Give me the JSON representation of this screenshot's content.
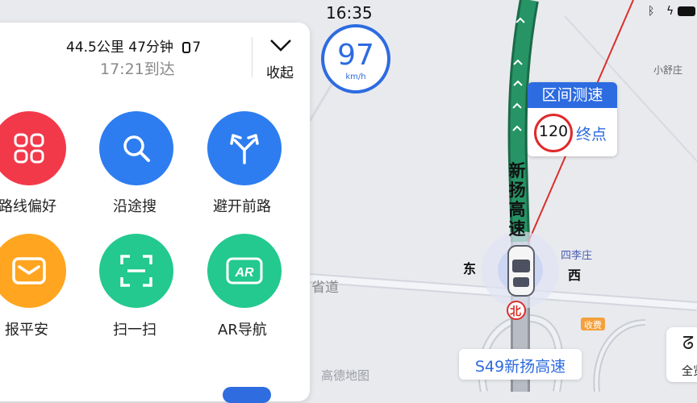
{
  "status_bar": {
    "time": "16:35"
  },
  "panel": {
    "distance_time": "44.5公里 47分钟",
    "traffic_lights": "7",
    "eta": "17:21到达",
    "collapse_label": "收起",
    "functions": [
      {
        "label": "路线偏好",
        "icon": "route-preference-icon",
        "color": "#f2394a"
      },
      {
        "label": "沿途搜",
        "icon": "search-icon",
        "color": "#2d7df0"
      },
      {
        "label": "避开前路",
        "icon": "avoid-road-icon",
        "color": "#2d7df0"
      },
      {
        "label": "报平安",
        "icon": "mail-icon",
        "color": "#ffa51f"
      },
      {
        "label": "扫一扫",
        "icon": "scan-icon",
        "color": "#23c98f"
      },
      {
        "label": "AR导航",
        "icon": "ar-icon",
        "color": "#23c98f"
      }
    ]
  },
  "speed": {
    "value": "97",
    "unit": "km/h"
  },
  "section_speed": {
    "title": "区间测速",
    "limit": "120",
    "end_label": "终点"
  },
  "map_labels": {
    "road_vertical": "新扬高速",
    "east": "东",
    "west": "西",
    "north": "北",
    "village1": "四李庄",
    "village2": "小舒庄",
    "province_road": "省道",
    "toll": "收费",
    "watermark": "高德地图"
  },
  "current_road": "S49新扬高速",
  "overview_label": "全览",
  "colors": {
    "accent": "#2d6be0",
    "route_green": "#1f8a5e",
    "limit_red": "#e02a2a"
  }
}
